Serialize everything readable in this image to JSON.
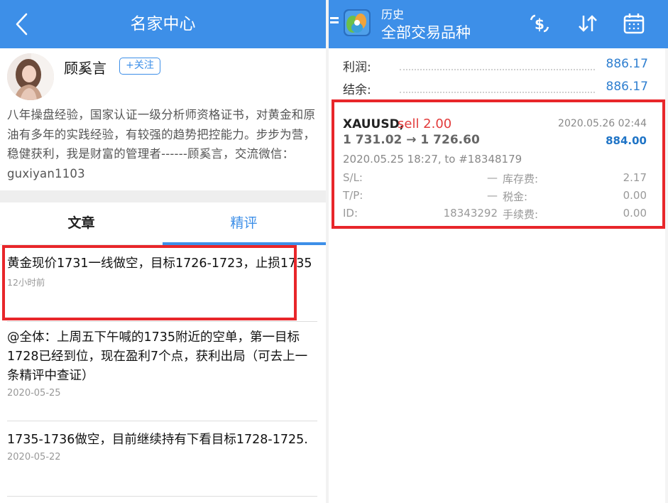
{
  "left_panel": {
    "header": {
      "title": "名家中心"
    },
    "profile": {
      "name": "顾奚言",
      "follow_label": "+关注",
      "bio": "八年操盘经验，国家认证一级分析师资格证书，对黄金和原油有多年的实践经验，有较强的趋势把控能力。步步为营，稳健获利，我是财富的管理者------顾奚言，交流微信：guxiyan1103"
    },
    "tabs": [
      {
        "label": "文章",
        "active": false
      },
      {
        "label": "精评",
        "active": true
      }
    ],
    "posts": [
      {
        "text": "黄金现价1731一线做空，目标1726-1723，止损1735",
        "date": "12小时前"
      },
      {
        "text": "@全体：上周五下午喊的1735附近的空单，第一目标1728已经到位，现在盈利7个点，获利出局（可去上一条精评中查证）",
        "date": "2020-05-25"
      },
      {
        "text": "1735-1736做空，目前继续持有下看目标1728-1725.",
        "date": "2020-05-22"
      }
    ],
    "colors": {
      "accent": "#3d8fe8",
      "highlight": "#e8262a"
    }
  },
  "right_panel": {
    "header": {
      "subtitle": "历史",
      "title": "全部交易品种",
      "icons": [
        "menu-icon",
        "app-logo-icon",
        "currency-exchange-icon",
        "sort-icon",
        "calendar-icon"
      ]
    },
    "summary": [
      {
        "label": "利润:",
        "value": "886.17"
      },
      {
        "label": "结余:",
        "value": "886.17"
      }
    ],
    "trade": {
      "symbol": "XAUUSD,",
      "type": "sell 2.00",
      "close_time": "2020.05.26 02:44",
      "prices": "1 731.02 → 1 726.60",
      "profit": "884.00",
      "open_info": "2020.05.25 18:27, to #18348179",
      "details": [
        {
          "label": "S/L:",
          "value": "—",
          "label2": "库存费:",
          "value2": "2.17"
        },
        {
          "label": "T/P:",
          "value": "—",
          "label2": "税金:",
          "value2": "0.00"
        },
        {
          "label": "ID:",
          "value": "18343292",
          "label2": "手续费:",
          "value2": "0.00"
        }
      ]
    },
    "colors": {
      "profit": "#1f74c6",
      "sell": "#e23b3b"
    }
  }
}
